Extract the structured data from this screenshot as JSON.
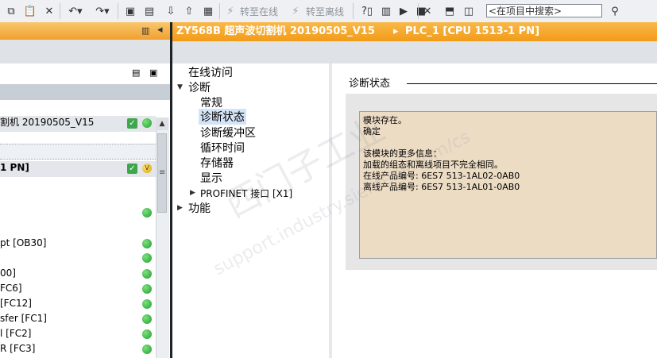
{
  "toolbar": {
    "go_online_label": "转至在线",
    "go_offline_label": "转至离线",
    "search_placeholder": "<在项目中搜索>"
  },
  "left_panel": {
    "rows": [
      {
        "label": "割机 20190505_V15",
        "status": "green"
      },
      {
        "label": "",
        "status": "none"
      },
      {
        "label": "1 PN]",
        "status": "yellow"
      },
      {
        "label": "",
        "status": "none"
      },
      {
        "label": "",
        "status": "green"
      },
      {
        "label": "",
        "status": "none"
      },
      {
        "label": "pt [OB30]",
        "status": "green"
      },
      {
        "label": "",
        "status": "green"
      },
      {
        "label": "00]",
        "status": "green"
      },
      {
        "label": "FC6]",
        "status": "green"
      },
      {
        "label": "[FC12]",
        "status": "green"
      },
      {
        "label": "sfer [FC1]",
        "status": "green"
      },
      {
        "label": "l [FC2]",
        "status": "green"
      },
      {
        "label": "R [FC3]",
        "status": "green"
      }
    ]
  },
  "header": {
    "device": "ZY568B 超声波切割机 20190505_V15",
    "separator": "▸",
    "plc": "PLC_1 [CPU 1513-1 PN]"
  },
  "nav": {
    "online_access": "在线访问",
    "diagnostics": "诊断",
    "general": "常规",
    "diagnostic_status": "诊断状态",
    "diagnostic_buffer": "诊断缓冲区",
    "cycle_time": "循环时间",
    "memory": "存储器",
    "display": "显示",
    "profinet": "PROFINET 接口 [X1]",
    "functions": "功能"
  },
  "content": {
    "section_title": "诊断状态",
    "messages": [
      "模块存在。",
      "确定",
      "",
      "该模块的更多信息：",
      "加载的组态和离线项目不完全相同。",
      "在线产品编号:  6ES7 513-1AL02-0AB0",
      "离线产品编号:  6ES7 513-1AL01-0AB0"
    ]
  },
  "watermark": {
    "line1": "西门子工业",
    "line2": "support.industry.siemens.com/cs"
  },
  "colors": {
    "accent_orange": "#f29b18",
    "status_green": "#2fa83c",
    "message_bg": "#ecdcc4"
  }
}
